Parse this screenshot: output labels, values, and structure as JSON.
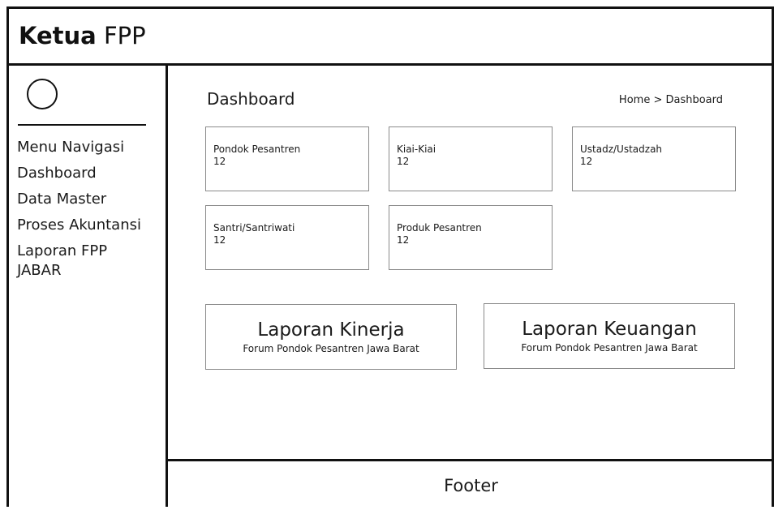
{
  "header": {
    "title_bold": "Ketua",
    "title_rest": "FPP"
  },
  "sidebar": {
    "items": [
      {
        "label": "Menu Navigasi"
      },
      {
        "label": "Dashboard"
      },
      {
        "label": "Data Master"
      },
      {
        "label": "Proses Akuntansi"
      },
      {
        "label": "Laporan FPP JABAR"
      }
    ]
  },
  "main": {
    "title": "Dashboard",
    "breadcrumb": "Home > Dashboard",
    "cards": [
      {
        "label": "Pondok Pesantren",
        "value": "12"
      },
      {
        "label": "Kiai-Kiai",
        "value": "12"
      },
      {
        "label": "Ustadz/Ustadzah",
        "value": "12"
      },
      {
        "label": "Santri/Santriwati",
        "value": "12"
      },
      {
        "label": "Produk Pesantren",
        "value": "12"
      }
    ],
    "reports": [
      {
        "title": "Laporan Kinerja",
        "subtitle": "Forum  Pondok  Pesantren Jawa Barat"
      },
      {
        "title": "Laporan Keuangan",
        "subtitle": "Forum  Pondok  Pesantren Jawa Barat"
      }
    ]
  },
  "footer": {
    "label": "Footer"
  }
}
